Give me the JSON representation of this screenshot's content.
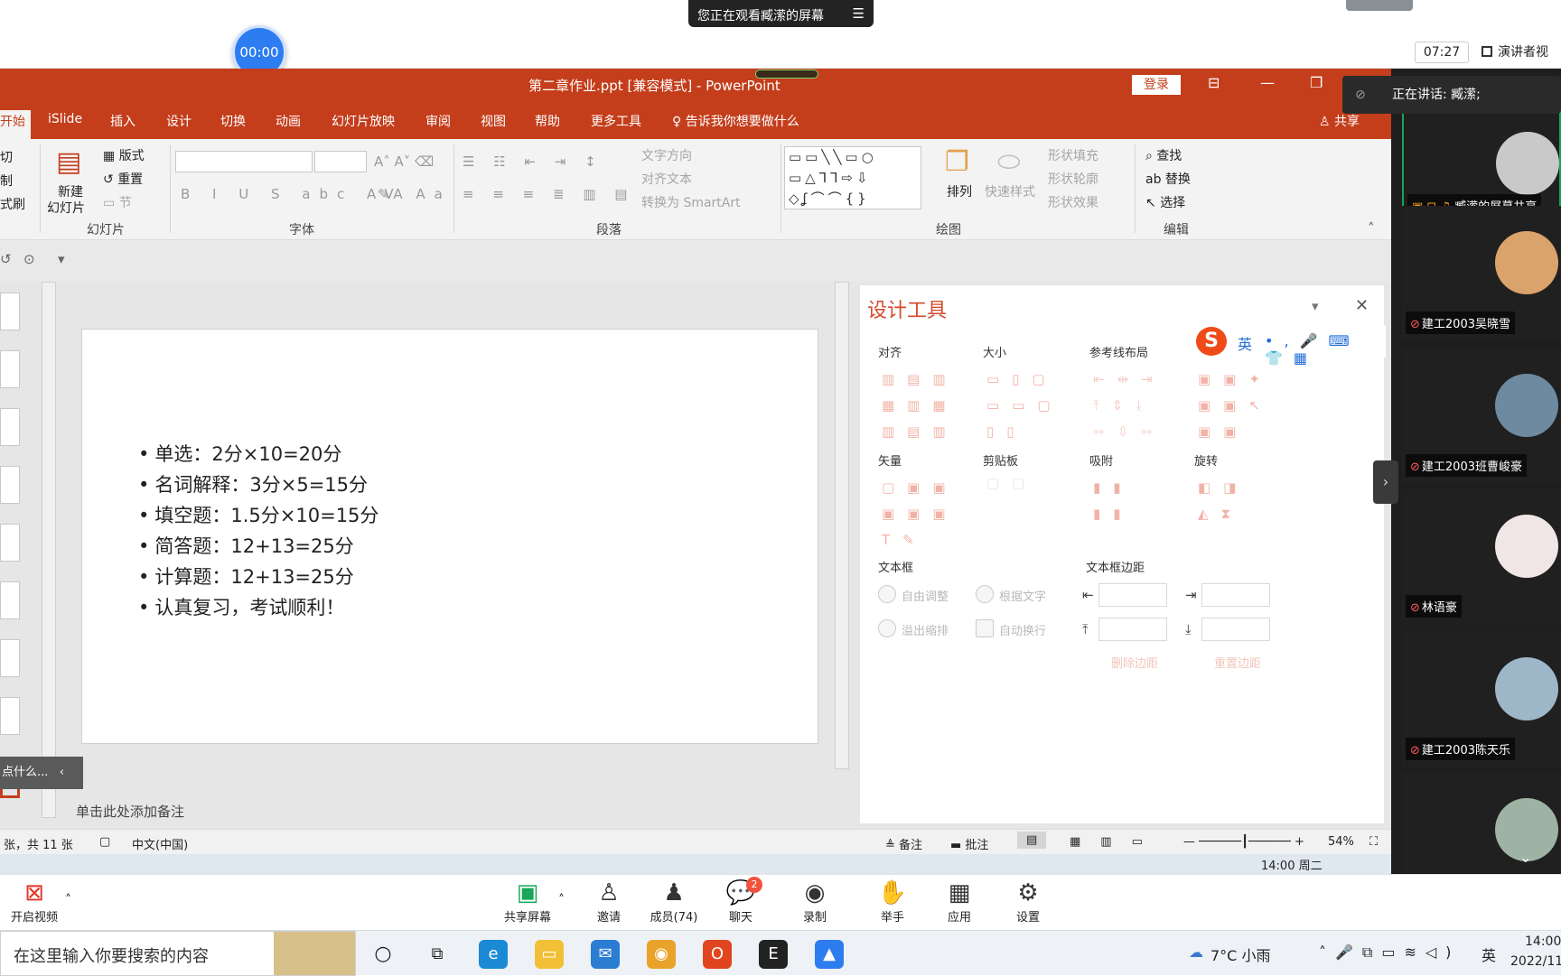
{
  "top": {
    "viewing_label": "您正在观看臧潆的屏幕",
    "timer": "00:00",
    "clock": "07:27",
    "presenter_view": "演讲者视"
  },
  "ppt": {
    "window_title": "第二章作业.ppt [兼容模式] - PowerPoint",
    "login_label": "登录",
    "tabs": [
      "开始",
      "iSlide",
      "插入",
      "设计",
      "切换",
      "动画",
      "幻灯片放映",
      "审阅",
      "视图",
      "帮助",
      "更多工具",
      "告诉我你想要做什么",
      "共享"
    ],
    "ribbon": {
      "clipboard": [
        "切",
        "制",
        "式刷"
      ],
      "new_slide": "新建",
      "new_slide2": "幻灯片",
      "layout": "版式",
      "reset": "重置",
      "section": "节",
      "group_slides": "幻灯片",
      "group_font": "字体",
      "group_paragraph": "段落",
      "group_drawing": "绘图",
      "group_editing": "编辑",
      "text_direction": "文字方向",
      "align_text": "对齐文本",
      "smartart": "转换为 SmartArt",
      "arrange": "排列",
      "quick_styles": "快速样式",
      "shape_fill": "形状填充",
      "shape_outline": "形状轮廓",
      "shape_effects": "形状效果",
      "find": "查找",
      "replace": "替换",
      "select": "选择"
    },
    "slide": {
      "bullets": [
        "单选：2分×10=20分",
        "名词解释：3分×5=15分",
        "填空题：1.5分×10=15分",
        "简答题：12+13=25分",
        "计算题：12+13=25分",
        "认真复习，考试顺利！"
      ]
    },
    "notes_placeholder": "单击此处添加备注",
    "tooltip_text": "点什么...",
    "status": {
      "slide_count": "张，共 11 张",
      "language": "中文(中国)",
      "notes": "备注",
      "comments": "批注",
      "zoom": "54%"
    },
    "strip_time": "14:00 周二"
  },
  "design_panel": {
    "title": "设计工具",
    "sections": {
      "align": "对齐",
      "size": "大小",
      "guides": "参考线布局",
      "vector": "矢量",
      "clipboard": "剪贴板",
      "snap": "吸附",
      "rotate": "旋转",
      "textbox": "文本框",
      "margin": "文本框边距"
    },
    "options": {
      "auto_fit": "自由调整",
      "fit_text": "根据文字",
      "overflow": "溢出缩排",
      "wrap": "自动换行",
      "delete_margin": "删除边距",
      "reset_margin": "重置边距"
    },
    "sogou_lang": "英"
  },
  "meeting": {
    "speaking": "正在讲话: 臧潆;",
    "participants": [
      {
        "name": "臧潆的屏幕共享"
      },
      {
        "name": "建工2003吴晓雪"
      },
      {
        "name": "建工2003班曹峻豪"
      },
      {
        "name": "林语豪"
      },
      {
        "name": "建工2003陈天乐"
      }
    ],
    "toolbar": [
      {
        "label": "开启视频"
      },
      {
        "label": "共享屏幕"
      },
      {
        "label": "邀请"
      },
      {
        "label": "成员(74)"
      },
      {
        "label": "聊天"
      },
      {
        "label": "录制"
      },
      {
        "label": "举手"
      },
      {
        "label": "应用"
      },
      {
        "label": "设置"
      }
    ],
    "chat_badge": "2"
  },
  "taskbar": {
    "search_placeholder": "在这里输入你要搜索的内容",
    "weather": "7°C  小雨",
    "ime": "英",
    "time": "14:00",
    "date": "2022/11"
  },
  "colors": {
    "ppt_accent": "#c43e1c",
    "design_accent": "#d44a2a",
    "zoom_blue": "#2d7df0"
  }
}
